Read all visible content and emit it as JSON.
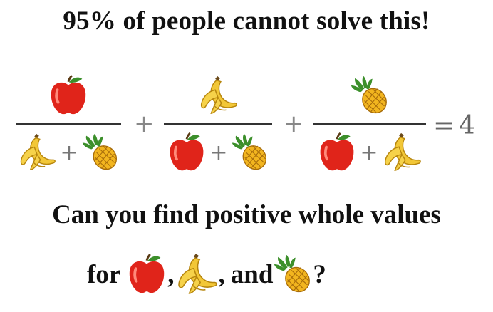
{
  "headline": "95% of people cannot solve this!",
  "equation": {
    "plus": "+",
    "equals": "=",
    "result": "4"
  },
  "question": "Can you find positive whole values",
  "line2": {
    "for": "for",
    "comma1": ",",
    "comma2": ",",
    "and": "and",
    "qmark": "?"
  },
  "icons": {
    "apple": "apple-icon",
    "banana": "banana-icon",
    "pineapple": "pineapple-icon"
  },
  "colors": {
    "apple": "#e0241a",
    "banana": "#f2c737",
    "pineapple": "#f2b51f",
    "leaf": "#3c8f2b"
  }
}
